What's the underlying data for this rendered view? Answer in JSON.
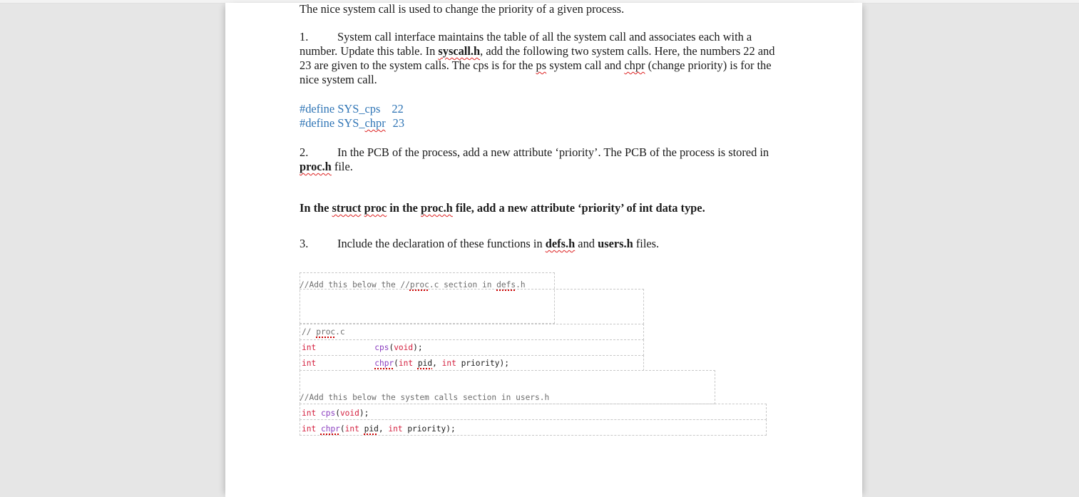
{
  "document": {
    "intro": "The nice system call is used to change the priority of a given process.",
    "step1": {
      "number": "1.",
      "text_a": "System call interface maintains the table of all the system call and associates each with a number. Update this table. In ",
      "file": "syscall.h",
      "text_b": ", add the following two system calls. Here, the numbers 22 and 23 are given to the system calls. The cps is for the ",
      "ps": "ps",
      "text_c": " system call and ",
      "chpr": "chpr",
      "text_d": " (change priority) is for the nice system call."
    },
    "defines": [
      {
        "directive": "#define",
        "name_prefix": "SYS_",
        "name": "cps",
        "value": "22"
      },
      {
        "directive": "#define",
        "name_prefix": "SYS_",
        "name": "chpr",
        "value": "23"
      }
    ],
    "step2": {
      "number": "2.",
      "text_a": "In the PCB of the process, add a new attribute ‘priority’. The PCB of the process is stored in ",
      "file": "proc.h",
      "text_b": " file."
    },
    "bold_note": {
      "text_a": "In the ",
      "struct": "struct",
      "space": " ",
      "proc": "proc",
      "text_b": " in the ",
      "file": "proc.h",
      "text_c": " file, add a new attribute ‘priority’ of int data type."
    },
    "step3": {
      "number": "3.",
      "text_a": "Include the declaration of these functions in ",
      "file1": "defs.h",
      "text_b": " and ",
      "file2": "users.h",
      "text_c": " files."
    },
    "code_defs": {
      "comment_a": "//Add this below the //",
      "comment_proc": "proc",
      "comment_b": ".c section in ",
      "comment_defs": "defs",
      "comment_c": ".h",
      "section_a": "// ",
      "section_proc": "proc",
      "section_b": ".c",
      "line1": {
        "type": "int",
        "fn": "cps",
        "open": "(",
        "arg": "void",
        "close": ");"
      },
      "line2": {
        "type": "int",
        "fn": "chpr",
        "open": "(",
        "arg1_type": "int",
        "arg1": "pid",
        "sep": ", ",
        "arg2_type": "int",
        "arg2": "priority",
        "close": ");"
      }
    },
    "code_users": {
      "comment": "//Add this below the system calls section in users.h",
      "line1": {
        "type": "int",
        "fn": "cps",
        "open": "(",
        "arg": "void",
        "close": ");"
      },
      "line2": {
        "type": "int",
        "fn": "chpr",
        "open": "(",
        "arg1_type": "int",
        "arg1": "pid",
        "sep": ", ",
        "arg2_type": "int",
        "arg2": "priority",
        "close": ");"
      }
    }
  },
  "colors": {
    "define_blue": "#2e74b5",
    "keyword_red": "#d4203f",
    "function_purple": "#8a3dbf",
    "comment_gray": "#6d6d6d"
  }
}
